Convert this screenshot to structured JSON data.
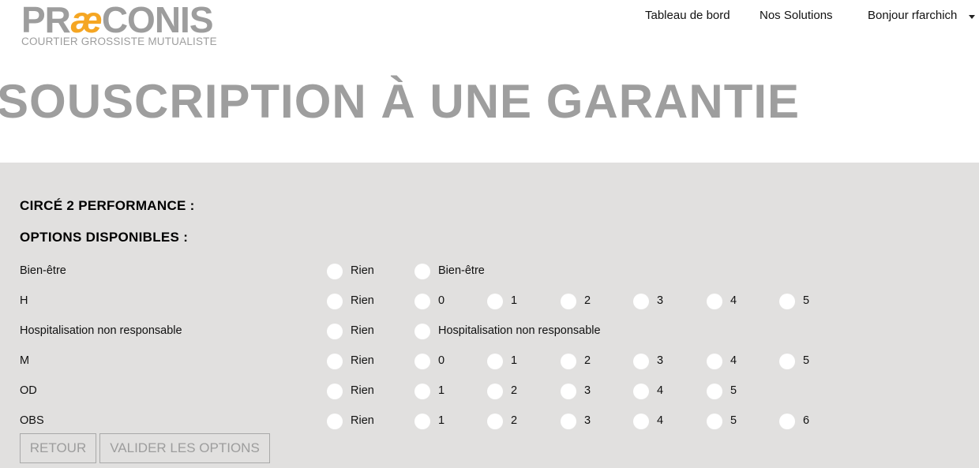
{
  "logo": {
    "word_start": "PR",
    "word_ae": "æ",
    "word_end": "CONIS",
    "tagline": "COURTIER GROSSISTE MUTUALISTE",
    "colors": {
      "grey": "#9d9d9d",
      "accent": "#f5a623"
    }
  },
  "nav": {
    "dashboard": "Tableau de bord",
    "solutions": "Nos Solutions",
    "user_greeting": "Bonjour rfarchich",
    "user_menu_icon": "caret-down-icon"
  },
  "page": {
    "title": "SOUSCRIPTION À UNE GARANTIE"
  },
  "panel": {
    "product_heading": "CIRCÉ 2 PERFORMANCE :",
    "options_heading": "OPTIONS DISPONIBLES :",
    "background": "#e1e0df",
    "options": [
      {
        "label": "Bien-être",
        "choices": [
          "Rien",
          "Bien-être"
        ]
      },
      {
        "label": "H",
        "choices": [
          "Rien",
          "0",
          "1",
          "2",
          "3",
          "4",
          "5"
        ]
      },
      {
        "label": "Hospitalisation non responsable",
        "choices": [
          "Rien",
          "Hospitalisation non responsable"
        ]
      },
      {
        "label": "M",
        "choices": [
          "Rien",
          "0",
          "1",
          "2",
          "3",
          "4",
          "5"
        ]
      },
      {
        "label": "OD",
        "choices": [
          "Rien",
          "1",
          "2",
          "3",
          "4",
          "5"
        ]
      },
      {
        "label": "OBS",
        "choices": [
          "Rien",
          "1",
          "2",
          "3",
          "4",
          "5",
          "6"
        ]
      }
    ]
  },
  "buttons": {
    "back": "RETOUR",
    "validate": "VALIDER LES OPTIONS"
  }
}
